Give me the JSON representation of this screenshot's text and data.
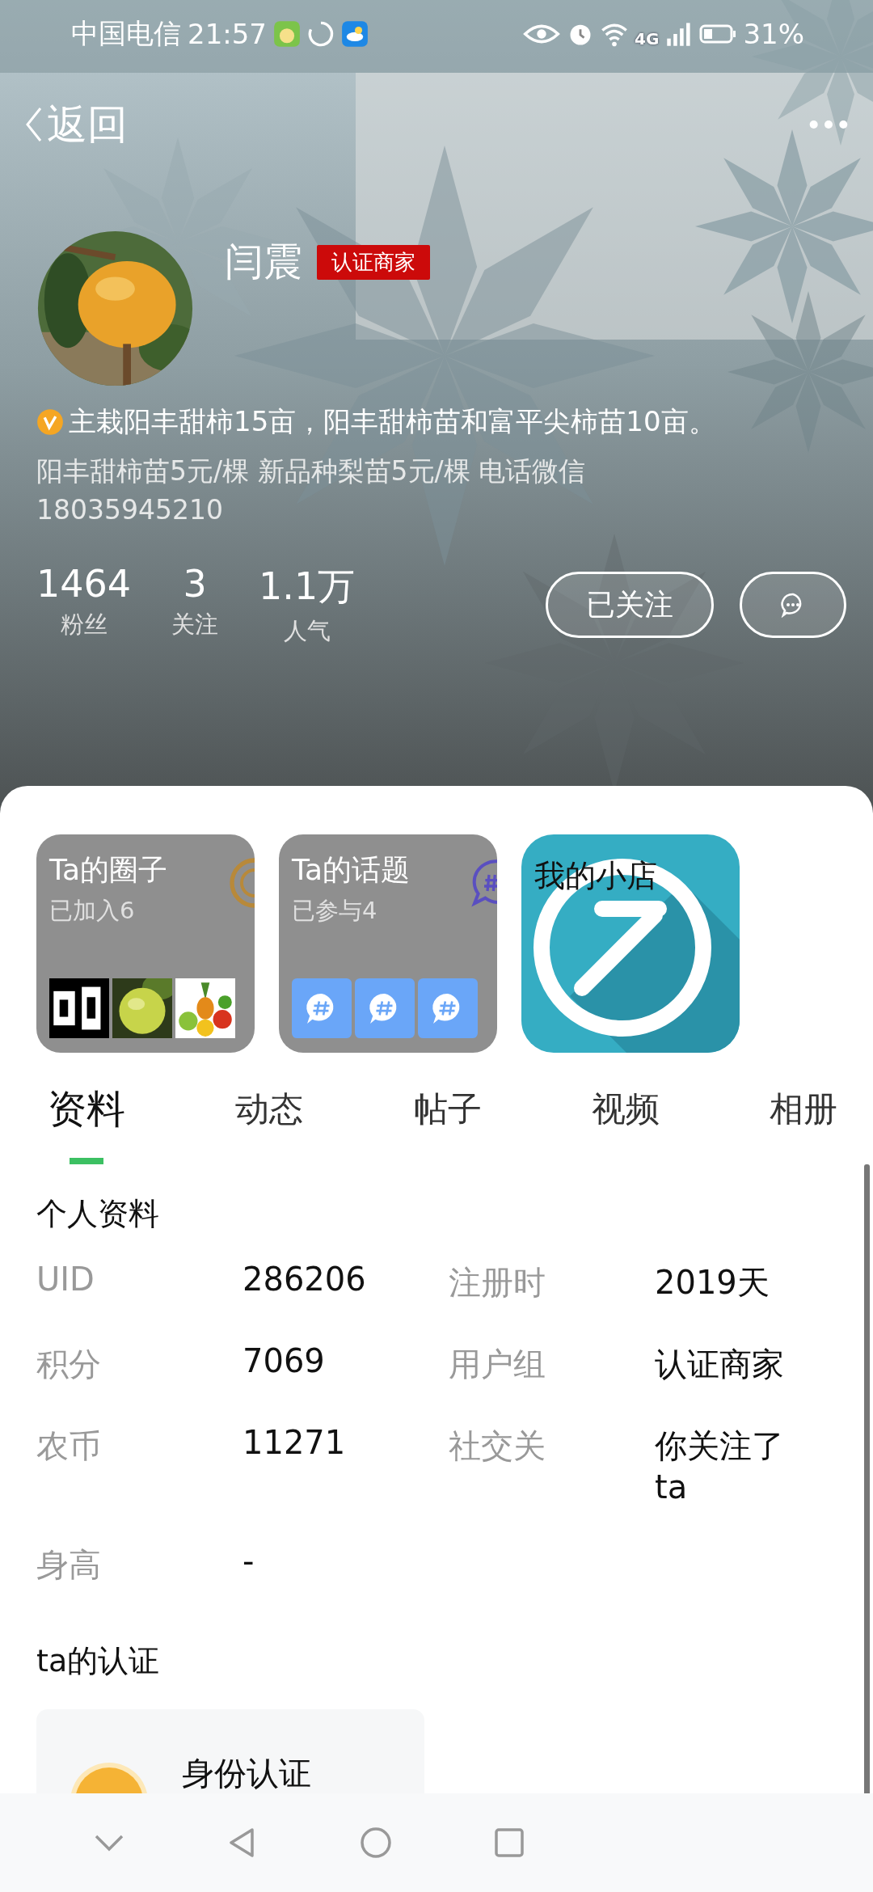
{
  "status_bar": {
    "carrier": "中国电信",
    "time": "21:57",
    "battery": "31%",
    "network": "4G"
  },
  "top_bar": {
    "back_label": "返回"
  },
  "profile": {
    "name": "闫震",
    "badge": "认证商家",
    "bio": "主栽阳丰甜柿15亩，阳丰甜柿苗和富平尖柿苗10亩。",
    "description": "阳丰甜柿苗5元/棵  新品种梨苗5元/棵 电话微信 18035945210",
    "stats": [
      {
        "value": "1464",
        "label": "粉丝"
      },
      {
        "value": "3",
        "label": "关注"
      },
      {
        "value": "1.1万",
        "label": "人气"
      }
    ],
    "follow_button": "已关注"
  },
  "cards": [
    {
      "kind": "circles",
      "title": "Ta的圈子",
      "subtitle": "已加入6"
    },
    {
      "kind": "topics",
      "title": "Ta的话题",
      "subtitle": "已参与4"
    },
    {
      "kind": "shop",
      "title": "我的小店"
    }
  ],
  "tabs": [
    {
      "label": "资料",
      "selected": true
    },
    {
      "label": "动态",
      "selected": false
    },
    {
      "label": "帖子",
      "selected": false
    },
    {
      "label": "视频",
      "selected": false
    },
    {
      "label": "相册",
      "selected": false
    }
  ],
  "profile_info": {
    "title": "个人资料",
    "fields": [
      {
        "label": "UID",
        "value": "286206"
      },
      {
        "label": "注册时",
        "value": "2019天"
      },
      {
        "label": "积分",
        "value": "7069"
      },
      {
        "label": "用户组",
        "value": "认证商家"
      },
      {
        "label": "农币",
        "value": "11271"
      },
      {
        "label": "社交关",
        "value": "你关注了ta"
      },
      {
        "label": "身高",
        "value": "-"
      }
    ]
  },
  "certification": {
    "title": "ta的认证",
    "card_title": "身份认证"
  }
}
